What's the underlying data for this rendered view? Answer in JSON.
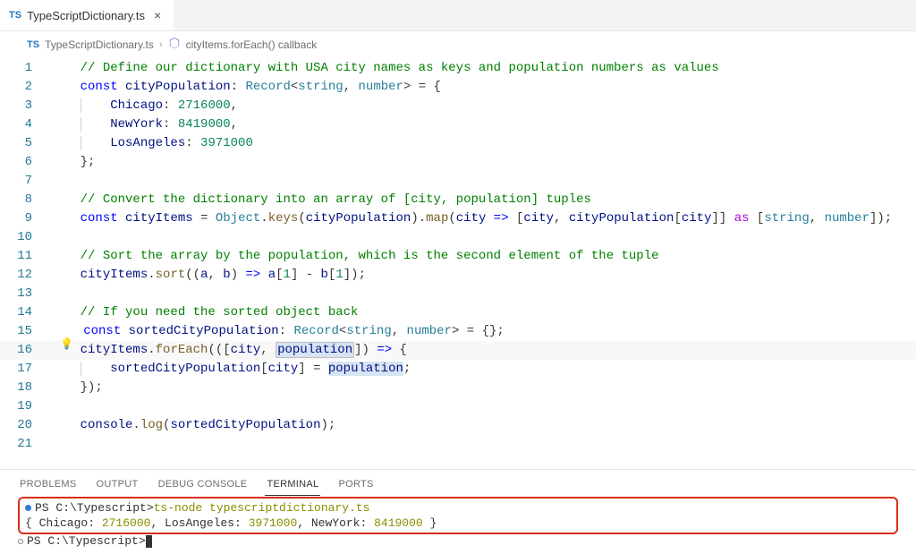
{
  "tab": {
    "icon": "TS",
    "label": "TypeScriptDictionary.ts"
  },
  "breadcrumbs": {
    "fileIcon": "TS",
    "file": "TypeScriptDictionary.ts",
    "symbolIcon": "cube",
    "symbol": "cityItems.forEach() callback"
  },
  "code": {
    "l1": "// Define our dictionary with USA city names as keys and population numbers as values",
    "l2_kw": "const",
    "l2_var": "cityPopulation",
    "l2_type1": "Record",
    "l2_type2": "string",
    "l2_type3": "number",
    "l3_key": "Chicago",
    "l3_val": "2716000",
    "l4_key": "NewYork",
    "l4_val": "8419000",
    "l5_key": "LosAngeles",
    "l5_val": "3971000",
    "l8": "// Convert the dictionary into an array of [city, population] tuples",
    "l9_kw": "const",
    "l9_var": "cityItems",
    "l9_obj": "Object",
    "l9_keys": "keys",
    "l9_arg": "cityPopulation",
    "l9_map": "map",
    "l9_param": "city",
    "l9_ret1": "city",
    "l9_ret2": "cityPopulation",
    "l9_ret3": "city",
    "l9_as": "as",
    "l9_t1": "string",
    "l9_t2": "number",
    "l11": "// Sort the array by the population, which is the second element of the tuple",
    "l12_var": "cityItems",
    "l12_sort": "sort",
    "l12_a": "a",
    "l12_b": "b",
    "l12_i1": "1",
    "l12_i2": "1",
    "l14": "// If you need the sorted object back",
    "l15_kw": "const",
    "l15_var": "sortedCityPopulation",
    "l15_t1": "Record",
    "l15_t2": "string",
    "l15_t3": "number",
    "l16_var": "cityItems",
    "l16_fe": "forEach",
    "l16_p1": "city",
    "l16_p2": "population",
    "l17_var": "sortedCityPopulation",
    "l17_k": "city",
    "l17_v": "population",
    "l20_fn": "console",
    "l20_log": "log",
    "l20_arg": "sortedCityPopulation"
  },
  "linenos": [
    "1",
    "2",
    "3",
    "4",
    "5",
    "6",
    "7",
    "8",
    "9",
    "10",
    "11",
    "12",
    "13",
    "14",
    "15",
    "16",
    "17",
    "18",
    "19",
    "20",
    "21"
  ],
  "panel": {
    "tabs": [
      "PROBLEMS",
      "OUTPUT",
      "DEBUG CONSOLE",
      "TERMINAL",
      "PORTS"
    ],
    "active": 3
  },
  "terminal": {
    "prompt1_path": "PS C:\\Typescript>",
    "prompt1_cmd": "ts-node typescriptdictionary.ts",
    "output_pre": "{ Chicago: ",
    "output_v1": "2716000",
    "output_mid1": ", LosAngeles: ",
    "output_v2": "3971000",
    "output_mid2": ", NewYork: ",
    "output_v3": "8419000",
    "output_post": " }",
    "prompt2_path": "PS C:\\Typescript>"
  }
}
